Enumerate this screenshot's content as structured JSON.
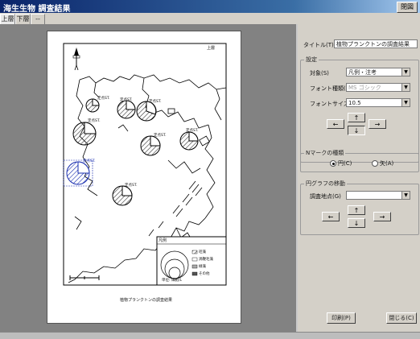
{
  "window": {
    "title": "海生生物 調査結果",
    "close_label": "閉図"
  },
  "tabs": [
    {
      "label": "上層"
    },
    {
      "label": "下層"
    },
    {
      "label": "--"
    }
  ],
  "map": {
    "page_label": "上層",
    "caption": "植物プランクトンの調査結果",
    "survey_labels": [
      "定点ST.",
      "定点ST.",
      "定点ST.",
      "定点ST.",
      "定点ST.",
      "定点ST.",
      "定点ST.",
      "定点ST."
    ],
    "legend_title": "凡例",
    "legend_items": [
      "珪藻",
      "渦鞭毛藻",
      "緑藻",
      "その他"
    ],
    "scale_label": "単位: 細胞/L"
  },
  "settings": {
    "title_label": "タイトル(T)",
    "title_value": "植物プランクトンの調査結果",
    "group_label": "設定",
    "target_label": "対象(S)",
    "target_value": "凡例・注考",
    "font_type_label": "フォント種類(F)",
    "font_type_value": "MS ゴシック",
    "font_size_label": "フォントサイズ(Z)",
    "font_size_value": "10.5"
  },
  "north_mark": {
    "group_label": "Nマークの種類",
    "options": [
      {
        "label": "円(C)",
        "selected": true
      },
      {
        "label": "矢(A)",
        "selected": false
      }
    ]
  },
  "pie_move": {
    "group_label": "円グラフの移動",
    "point_label": "調査地点(G)",
    "point_value": ""
  },
  "arrows": {
    "up": "↑",
    "down": "↓",
    "left": "←",
    "right": "→"
  },
  "footer": {
    "print_label": "印刷(P)",
    "close_label": "閉じる(C)"
  },
  "colors": {
    "titlebar": "#0a246a",
    "panel": "#d4d0c8",
    "preview_bg": "#828282",
    "selected_chart": "#1a2fb0"
  }
}
